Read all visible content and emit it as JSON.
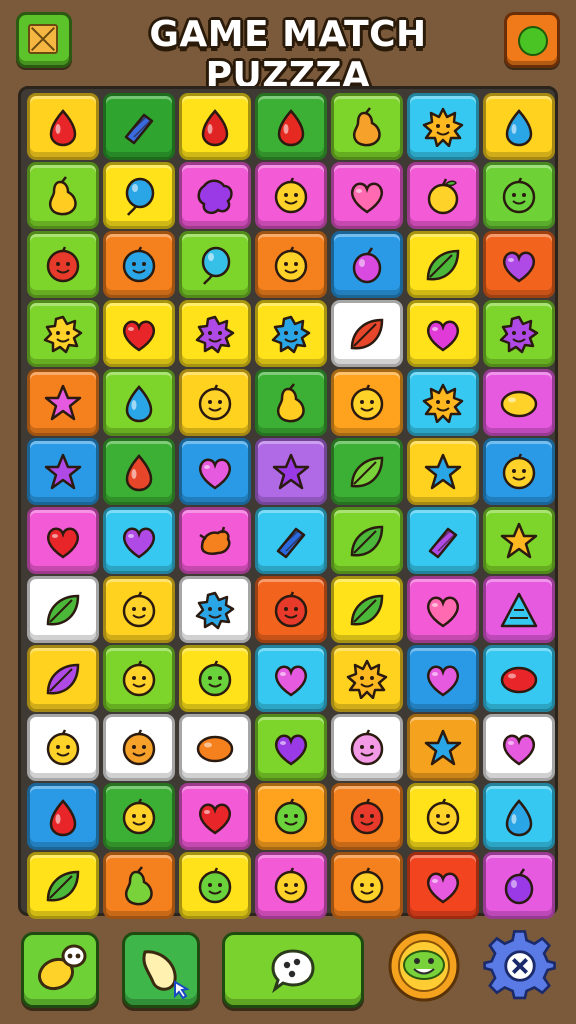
{
  "header": {
    "title": "GAME MATCH PUZZZA",
    "left_button_icon": "crossed-box-icon",
    "right_button_icon": "green-orb-icon"
  },
  "board": {
    "rows": [
      [
        {
          "bg": "#ffd21f",
          "shape": "drop",
          "color": "#e8262a"
        },
        {
          "bg": "#2fa52f",
          "shape": "candy",
          "color": "#3a6ae0"
        },
        {
          "bg": "#ffe21a",
          "shape": "drop",
          "color": "#e02424"
        },
        {
          "bg": "#3cb034",
          "shape": "drop",
          "color": "#e62a22"
        },
        {
          "bg": "#7dd42a",
          "shape": "pear",
          "color": "#f5a12a"
        },
        {
          "bg": "#36c8f0",
          "shape": "sun",
          "color": "#ffb820"
        },
        {
          "bg": "#ffd21f",
          "shape": "drop",
          "color": "#2aa6e6"
        }
      ],
      [
        {
          "bg": "#7dd42a",
          "shape": "pear",
          "color": "#ffcc22"
        },
        {
          "bg": "#ffe21a",
          "shape": "balloon",
          "color": "#2aa6e6"
        },
        {
          "bg": "#f25ad6",
          "shape": "blob",
          "color": "#9a3ae6"
        },
        {
          "bg": "#f25ad6",
          "shape": "face",
          "color": "#ffd22a"
        },
        {
          "bg": "#f25ad6",
          "shape": "heart",
          "color": "#ff6ab0"
        },
        {
          "bg": "#f25ad6",
          "shape": "apple",
          "color": "#ffd22a"
        },
        {
          "bg": "#6ed236",
          "shape": "face",
          "color": "#6ad23a"
        }
      ],
      [
        {
          "bg": "#7dd42a",
          "shape": "face",
          "color": "#e83a2a"
        },
        {
          "bg": "#f5801e",
          "shape": "face",
          "color": "#2aa6e6"
        },
        {
          "bg": "#7dd42a",
          "shape": "balloon",
          "color": "#36c0e8"
        },
        {
          "bg": "#f5801e",
          "shape": "face",
          "color": "#ffd22a"
        },
        {
          "bg": "#2a9ae6",
          "shape": "plum",
          "color": "#d84ae0"
        },
        {
          "bg": "#ffe21a",
          "shape": "leaf",
          "color": "#4cb83a"
        },
        {
          "bg": "#f2641e",
          "shape": "heart",
          "color": "#b04ae6"
        }
      ],
      [
        {
          "bg": "#7dd42a",
          "shape": "burst",
          "color": "#ffd22a"
        },
        {
          "bg": "#ffe21a",
          "shape": "heart",
          "color": "#e8262a"
        },
        {
          "bg": "#ffe21a",
          "shape": "burst",
          "color": "#b04ae6"
        },
        {
          "bg": "#ffe21a",
          "shape": "burst",
          "color": "#2aa6e6"
        },
        {
          "bg": "#ffffff",
          "shape": "leaf",
          "color": "#e8462a"
        },
        {
          "bg": "#ffe21a",
          "shape": "heart",
          "color": "#e03ad8"
        },
        {
          "bg": "#7dd42a",
          "shape": "burst",
          "color": "#b04ae6"
        }
      ],
      [
        {
          "bg": "#f5801e",
          "shape": "star",
          "color": "#e65ae0"
        },
        {
          "bg": "#7dd42a",
          "shape": "drop",
          "color": "#2aa6e6"
        },
        {
          "bg": "#ffd21f",
          "shape": "face",
          "color": "#ffd22a"
        },
        {
          "bg": "#3cb034",
          "shape": "pear",
          "color": "#ffcc22"
        },
        {
          "bg": "#ffa21e",
          "shape": "face",
          "color": "#ffd22a"
        },
        {
          "bg": "#36c8f0",
          "shape": "sun",
          "color": "#ffb820"
        },
        {
          "bg": "#e65ae0",
          "shape": "lemon",
          "color": "#ffd22a"
        }
      ],
      [
        {
          "bg": "#2a9ae6",
          "shape": "star",
          "color": "#b04ae6"
        },
        {
          "bg": "#3cb034",
          "shape": "drop",
          "color": "#e8462a"
        },
        {
          "bg": "#2a9ae6",
          "shape": "heart",
          "color": "#e65ae0"
        },
        {
          "bg": "#b06ae6",
          "shape": "star",
          "color": "#9a3ae6"
        },
        {
          "bg": "#3cb034",
          "shape": "leaf",
          "color": "#7ad23a"
        },
        {
          "bg": "#ffd21f",
          "shape": "star",
          "color": "#2aa6e6"
        },
        {
          "bg": "#2a9ae6",
          "shape": "face",
          "color": "#ffd22a"
        }
      ],
      [
        {
          "bg": "#f25ad6",
          "shape": "heart",
          "color": "#e8262a"
        },
        {
          "bg": "#36c8f0",
          "shape": "heart",
          "color": "#b04ae6"
        },
        {
          "bg": "#f25ad6",
          "shape": "crab",
          "color": "#f5801e"
        },
        {
          "bg": "#36c8f0",
          "shape": "candy",
          "color": "#2a6ae0"
        },
        {
          "bg": "#7dd42a",
          "shape": "leaf",
          "color": "#4cb83a"
        },
        {
          "bg": "#36c8f0",
          "shape": "candy",
          "color": "#b04ae6"
        },
        {
          "bg": "#7dd42a",
          "shape": "star",
          "color": "#ffb820"
        }
      ],
      [
        {
          "bg": "#ffffff",
          "shape": "leaf",
          "color": "#4cb83a"
        },
        {
          "bg": "#ffd21f",
          "shape": "face",
          "color": "#ffd22a"
        },
        {
          "bg": "#ffffff",
          "shape": "burst",
          "color": "#2aa6e6"
        },
        {
          "bg": "#f2641e",
          "shape": "face",
          "color": "#e83a2a"
        },
        {
          "bg": "#ffe21a",
          "shape": "leaf",
          "color": "#4cb83a"
        },
        {
          "bg": "#f25ad6",
          "shape": "heart",
          "color": "#ff6ab0"
        },
        {
          "bg": "#e65ae0",
          "shape": "pyramid",
          "color": "#36c8f0"
        }
      ],
      [
        {
          "bg": "#ffd21f",
          "shape": "leaf",
          "color": "#b04ae6"
        },
        {
          "bg": "#7dd42a",
          "shape": "face",
          "color": "#ffd22a"
        },
        {
          "bg": "#ffe21a",
          "shape": "face",
          "color": "#6ad23a"
        },
        {
          "bg": "#36c8f0",
          "shape": "heart",
          "color": "#e65ae0"
        },
        {
          "bg": "#ffd21f",
          "shape": "sun",
          "color": "#ffb820"
        },
        {
          "bg": "#2a9ae6",
          "shape": "heart",
          "color": "#e65ae0"
        },
        {
          "bg": "#36c8f0",
          "shape": "lemon",
          "color": "#e8262a"
        }
      ],
      [
        {
          "bg": "#ffffff",
          "shape": "face",
          "color": "#ffd22a"
        },
        {
          "bg": "#ffffff",
          "shape": "face",
          "color": "#f5a12a"
        },
        {
          "bg": "#ffffff",
          "shape": "lemon",
          "color": "#f5801e"
        },
        {
          "bg": "#7dd42a",
          "shape": "heart",
          "color": "#9a3ae6"
        },
        {
          "bg": "#ffffff",
          "shape": "face",
          "color": "#f29ae6"
        },
        {
          "bg": "#f5a21e",
          "shape": "star",
          "color": "#2aa6e6"
        },
        {
          "bg": "#ffffff",
          "shape": "heart",
          "color": "#e65ae0"
        }
      ],
      [
        {
          "bg": "#2a9ae6",
          "shape": "drop",
          "color": "#e8262a"
        },
        {
          "bg": "#3cb034",
          "shape": "face",
          "color": "#ffd22a"
        },
        {
          "bg": "#f25ad6",
          "shape": "heart",
          "color": "#e8262a"
        },
        {
          "bg": "#ffa21e",
          "shape": "face",
          "color": "#6ad23a"
        },
        {
          "bg": "#f5801e",
          "shape": "face",
          "color": "#e83a2a"
        },
        {
          "bg": "#ffe21a",
          "shape": "face",
          "color": "#ffd22a"
        },
        {
          "bg": "#36c8f0",
          "shape": "drop",
          "color": "#2aa6e6"
        }
      ],
      [
        {
          "bg": "#ffe21a",
          "shape": "leaf",
          "color": "#4cb83a"
        },
        {
          "bg": "#f5801e",
          "shape": "pear",
          "color": "#7ad23a"
        },
        {
          "bg": "#ffe21a",
          "shape": "face",
          "color": "#6ad23a"
        },
        {
          "bg": "#f25ad6",
          "shape": "face",
          "color": "#ffd22a"
        },
        {
          "bg": "#f5801e",
          "shape": "face",
          "color": "#ffd22a"
        },
        {
          "bg": "#f2441e",
          "shape": "heart",
          "color": "#e65ae0"
        },
        {
          "bg": "#e65ae0",
          "shape": "plum",
          "color": "#9a3ae6"
        }
      ]
    ]
  },
  "toolbar": {
    "buttons": [
      {
        "icon": "lemon-speech-icon"
      },
      {
        "icon": "pear-cursor-icon"
      },
      {
        "icon": "chat-bubble-icon"
      },
      {
        "icon": "smiley-coin-icon"
      },
      {
        "icon": "gear-icon"
      }
    ]
  }
}
